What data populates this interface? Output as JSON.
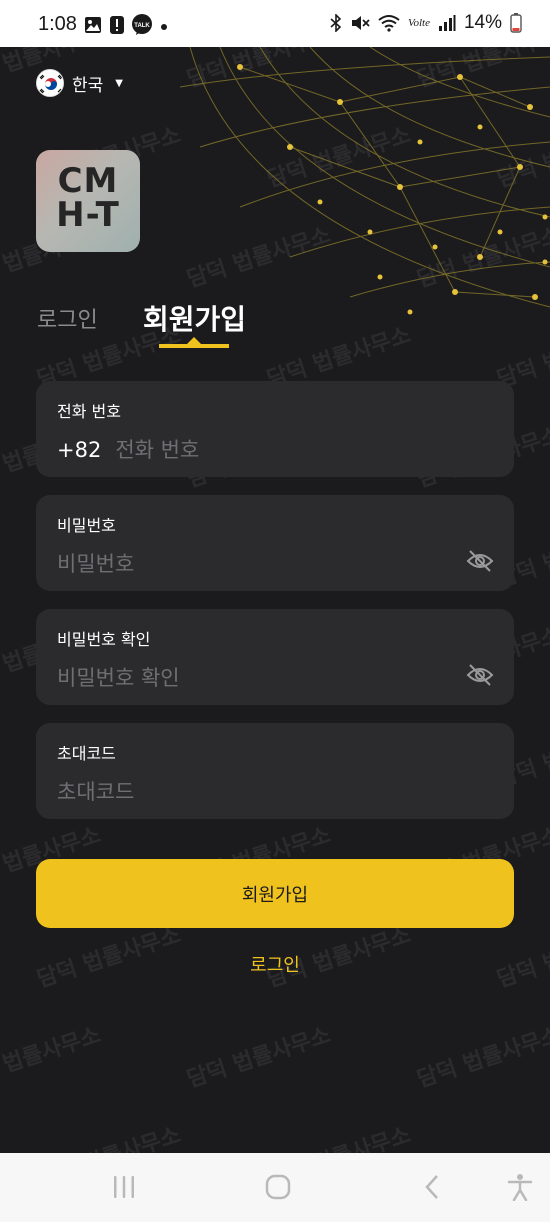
{
  "status_bar": {
    "time": "1:08",
    "battery": "14%",
    "icons_left": [
      "gallery-icon",
      "alert-icon",
      "talk-icon",
      "dot-icon"
    ],
    "talk_badge": "TALK",
    "icons_right": [
      "bluetooth-icon",
      "mute-icon",
      "wifi-icon",
      "volte-icon",
      "signal-icon",
      "battery-icon"
    ],
    "volte_text": "Volte"
  },
  "language": {
    "label": "한국"
  },
  "logo": {
    "line1": "CM",
    "line2": "H-T"
  },
  "tabs": {
    "login": "로그인",
    "signup": "회원가입",
    "active": "signup"
  },
  "form": {
    "phone": {
      "label": "전화 번호",
      "prefix": "+82",
      "placeholder": "전화 번호"
    },
    "password": {
      "label": "비밀번호",
      "placeholder": "비밀번호"
    },
    "password_confirm": {
      "label": "비밀번호 확인",
      "placeholder": "비밀번호 확인"
    },
    "invite_code": {
      "label": "초대코드",
      "placeholder": "초대코드"
    }
  },
  "submit_label": "회원가입",
  "login_link": "로그인",
  "colors": {
    "accent": "#f0c21e",
    "background": "#1b1b1d",
    "field": "#2b2b2e"
  },
  "watermark_text": "담덕 법률사무소"
}
